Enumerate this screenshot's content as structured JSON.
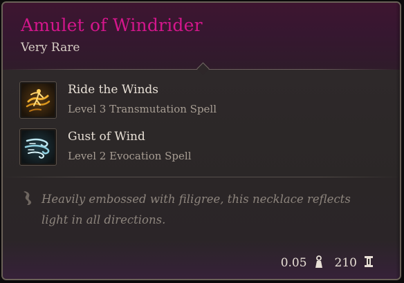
{
  "item": {
    "name": "Amulet of Windrider",
    "rarity": "Very Rare"
  },
  "colors": {
    "rarity_accent": "#d4168c",
    "text_primary": "#e8e0d6",
    "text_secondary": "#a89e94",
    "description_text": "#8d857d",
    "header_bg": "#3e1530"
  },
  "spells": [
    {
      "name": "Ride the Winds",
      "level": "Level 3 Transmutation Spell",
      "icon": "ride-the-winds-spell-icon"
    },
    {
      "name": "Gust of Wind",
      "level": "Level 2 Evocation Spell",
      "icon": "gust-of-wind-spell-icon"
    }
  ],
  "description": {
    "icon": "quill-icon",
    "text": "Heavily embossed with filigree, this necklace reflects light in all directions."
  },
  "footer": {
    "weight": "0.05",
    "weight_icon": "weight-icon",
    "value": "210",
    "value_icon": "gold-coin-icon"
  }
}
